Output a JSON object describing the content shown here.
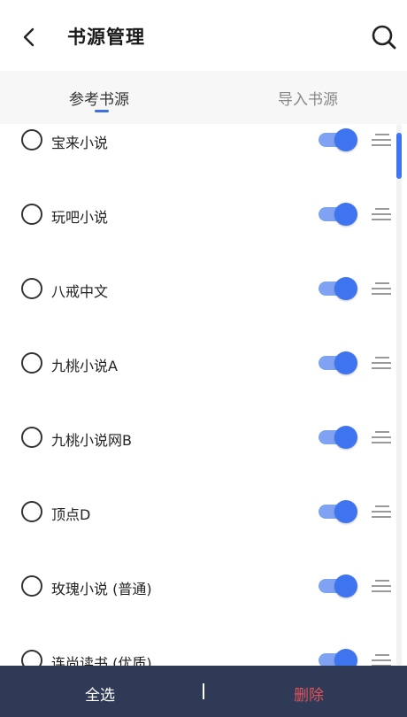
{
  "header": {
    "title": "书源管理",
    "back_icon": "back-arrow-icon",
    "search_icon": "search-icon"
  },
  "tabs": [
    {
      "label": "参考书源",
      "active": true
    },
    {
      "label": "导入书源",
      "active": false
    }
  ],
  "sources": [
    {
      "name": "宝来小说",
      "selected": false,
      "enabled": true
    },
    {
      "name": "玩吧小说",
      "selected": false,
      "enabled": true
    },
    {
      "name": "八戒中文",
      "selected": false,
      "enabled": true
    },
    {
      "name": "九桃小说A",
      "selected": false,
      "enabled": true
    },
    {
      "name": "九桃小说网B",
      "selected": false,
      "enabled": true
    },
    {
      "name": "顶点D",
      "selected": false,
      "enabled": true
    },
    {
      "name": "玫瑰小说 (普通)",
      "selected": false,
      "enabled": true
    },
    {
      "name": "连尚读书 (优质)",
      "selected": false,
      "enabled": true
    }
  ],
  "bottom_bar": {
    "select_all": "全选",
    "delete": "删除"
  },
  "colors": {
    "accent": "#3e74f0",
    "bottom_bar": "#2f3a57",
    "delete": "#e0535a"
  }
}
